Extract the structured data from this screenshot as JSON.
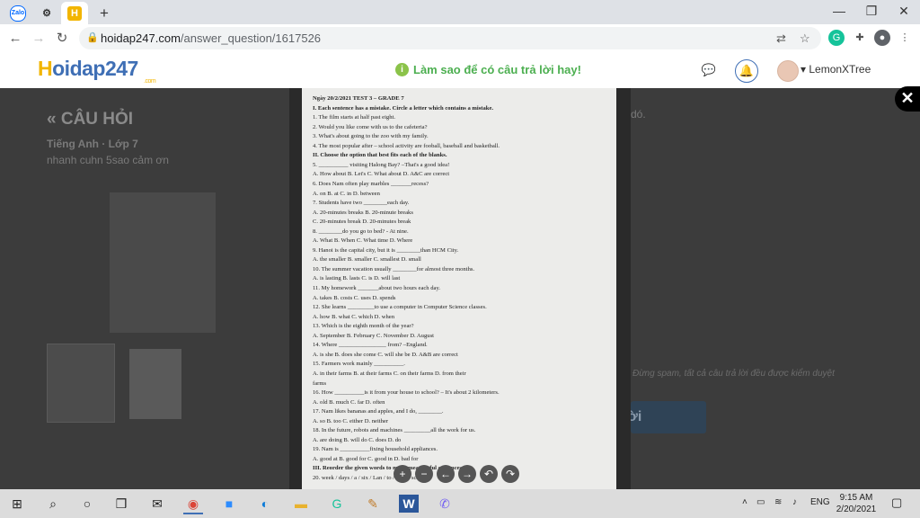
{
  "browser": {
    "tabs": [
      {
        "icon": "zalo-icon",
        "label": "Zalo"
      },
      {
        "icon": "gear-icon",
        "label": ""
      },
      {
        "icon": "hoidap-icon",
        "label": "H"
      }
    ],
    "new_tab": "+",
    "window_controls": [
      "—",
      "❐",
      "✕"
    ],
    "url_host": "hoidap247.com",
    "url_path": "/answer_question/1617526"
  },
  "site": {
    "logo_main": "oidap247",
    "logo_h": "H",
    "logo_domain": ".com",
    "tip": "Làm sao để có câu trả lời hay!",
    "username": "LemonXTree"
  },
  "question": {
    "title": "« CÂU HỎI",
    "subject": "Tiếng Anh · Lớp 7",
    "content": "nhanh cuhn 5sao cảm ơn",
    "spam_notice": "Đừng spam, tất cả câu trả lời đều được kiểm duyệt",
    "side_fragment": "dó.",
    "answer_button": "lời"
  },
  "paper": {
    "lines": [
      "Ngày 20/2/2021                                   TEST 3 – GRADE 7",
      "I.  Each sentence has a mistake. Circle a letter which contains a mistake.",
      "1. The film starts at half past eight.",
      "2. Would you like come with us to the cafeteria?",
      "3. What's about going to the zoo with my family.",
      "4. The most popular after – school activity are fooball, baseball and basketball.",
      "II. Choose the option that best fits each of the blanks.",
      "5. __________ visiting Halong Bay? –That's a good idea!",
      "   A. How about     B. Let's     C. What about     D. A&C are correct",
      "6. Does Nam often play marbles _______recess?",
      "   A. on     B. at     C. in     D. between",
      "7. Students have two ________each day.",
      "   A. 20-minutes breaks     B. 20-minute breaks",
      "   C. 20-minutes break      D. 20-minutes break",
      "8. ________do you go to bed? - At nine.",
      "   A. What     B. When     C. What time     D. Where",
      "9. Hanoi is the capital city, but it is ________than HCM City.",
      "   A. the smaller     B. smaller     C. smallest     D. small",
      "10. The summer vacation usually ________for almost three months.",
      "   A. is lasting     B. lasts     C. is     D. will last",
      "11. My homework _______about two hours each day.",
      "   A. takes     B. costs     C. uses     D. spends",
      "12. She learns _________to use a computer in Computer Science classes.",
      "   A. how     B. what     C. which     D. when",
      "13. Which is the eighth month of the year?",
      "   A. September     B. February     C. November     D. August",
      "14. Where ________________ from? –England.",
      "   A. is she     B. does she come     C. will she be     D. A&B are correct",
      "15. Farmers work mainly __________.",
      "   A. in their farms     B. at their farms     C. on their farms     D. from their",
      "farms",
      "16. How __________is it from your house to school? – It's about 2 kilometers.",
      "   A. old     B. much     C. far     D. often",
      "17. Nam likes bananas and apples, and I do, ________.",
      "   A. so     B. too     C. either     D. neither",
      "18. In the future, robots and machines _________all the work for us.",
      "   A. are doing     B. will do     C. does     D. do",
      "19. Nam is __________fixing household appliances.",
      "   A. good at     B. good for     C. good in     D. bad for",
      "III. Reorder the given words to make meaningful sentences.",
      "20. week / days / a / six / Lan / to / goes / school"
    ]
  },
  "viewer_controls": [
    "+",
    "−",
    "←",
    "→",
    "↶",
    "↷"
  ],
  "taskbar": {
    "items": [
      "windows-start-icon",
      "search-icon",
      "cortana-icon",
      "task-view-icon",
      "mail-icon",
      "chrome-icon",
      "zoom-icon",
      "edge-icon",
      "file-explorer-icon",
      "grammarly-icon",
      "paint-icon",
      "word-icon",
      "viber-icon"
    ],
    "language": "ENG",
    "time": "9:15 AM",
    "date": "2/20/2021"
  }
}
